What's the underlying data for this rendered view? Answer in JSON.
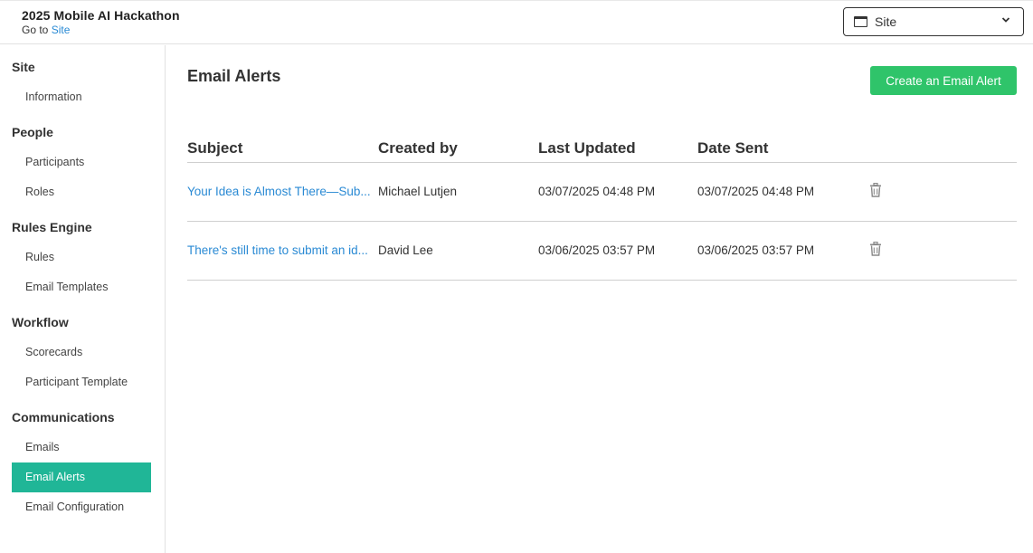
{
  "header": {
    "title": "2025 Mobile AI Hackathon",
    "goto_prefix": "Go to",
    "goto_link": "Site",
    "site_select": {
      "selected": "Site",
      "icon": "window-icon"
    }
  },
  "sidebar": {
    "sections": [
      {
        "label": "Site",
        "items": [
          "Information"
        ]
      },
      {
        "label": "People",
        "items": [
          "Participants",
          "Roles"
        ]
      },
      {
        "label": "Rules Engine",
        "items": [
          "Rules",
          "Email Templates"
        ]
      },
      {
        "label": "Workflow",
        "items": [
          "Scorecards",
          "Participant Template"
        ]
      },
      {
        "label": "Communications",
        "items": [
          "Emails",
          "Email Alerts",
          "Email Configuration"
        ]
      }
    ],
    "active_item": "Email Alerts"
  },
  "main": {
    "title": "Email Alerts",
    "create_button": "Create an Email Alert",
    "columns": [
      "Subject",
      "Created by",
      "Last Updated",
      "Date Sent"
    ],
    "rows": [
      {
        "subject": "Your Idea is Almost There—Sub...",
        "created_by": "Michael Lutjen",
        "last_updated": "03/07/2025 04:48 PM",
        "date_sent": "03/07/2025 04:48 PM",
        "action_icon": "trash-icon"
      },
      {
        "subject": "There's still time to submit an id...",
        "created_by": "David Lee",
        "last_updated": "03/06/2025 03:57 PM",
        "date_sent": "03/06/2025 03:57 PM",
        "action_icon": "trash-icon"
      }
    ]
  },
  "colors": {
    "accent_active": "#20b697",
    "create_button": "#2fc46a",
    "link": "#2a8ad4"
  }
}
